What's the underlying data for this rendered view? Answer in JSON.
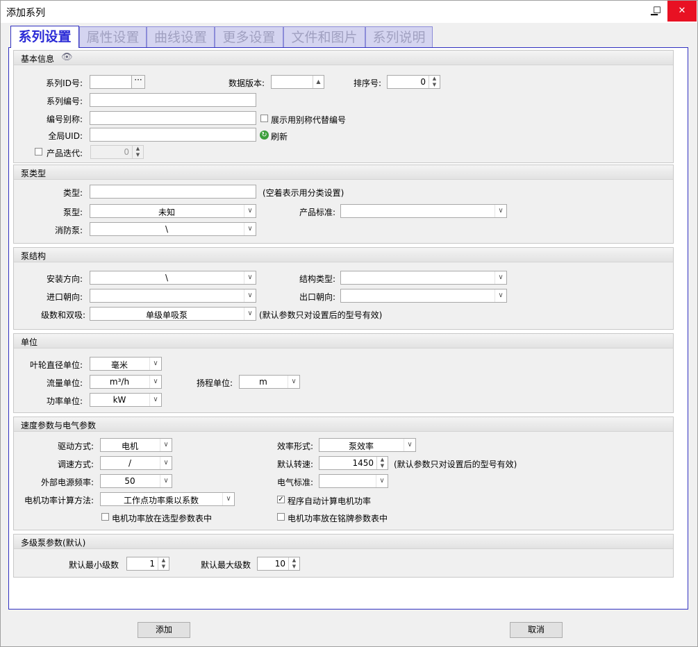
{
  "window": {
    "title": "添加系列",
    "min": "▁",
    "max": "☐",
    "close": "✕"
  },
  "tabs": [
    "系列设置",
    "属性设置",
    "曲线设置",
    "更多设置",
    "文件和图片",
    "系列说明"
  ],
  "basic": {
    "title": "基本信息",
    "series_id_label": "系列ID号:",
    "series_id_btn": "···",
    "data_version_label": "数据版本:",
    "sort_label": "排序号:",
    "sort_value": "0",
    "series_code_label": "系列编号:",
    "alias_label": "编号别称:",
    "alias_check_label": "展示用别称代替编号",
    "uid_label": "全局UID:",
    "refresh_label": "刷新",
    "iteration_label": "产品迭代:",
    "iteration_value": "0"
  },
  "pumptype": {
    "title": "泵类型",
    "type_label": "类型:",
    "type_hint": "(空着表示用分类设置)",
    "pump_label": "泵型:",
    "pump_value": "未知",
    "standard_label": "产品标准:",
    "standard_value": "",
    "fire_label": "消防泵:",
    "fire_value": "\\"
  },
  "structure": {
    "title": "泵结构",
    "install_label": "安装方向:",
    "install_value": "\\",
    "struct_type_label": "结构类型:",
    "struct_type_value": "",
    "inlet_label": "进口朝向:",
    "inlet_value": "",
    "outlet_label": "出口朝向:",
    "outlet_value": "",
    "stage_label": "级数和双吸:",
    "stage_value": "单级单吸泵",
    "stage_hint": "(默认参数只对设置后的型号有效)"
  },
  "units": {
    "title": "单位",
    "impeller_label": "叶轮直径单位:",
    "impeller_value": "毫米",
    "flow_label": "流量单位:",
    "flow_value": "m³/h",
    "head_label": "扬程单位:",
    "head_value": "m",
    "power_label": "功率单位:",
    "power_value": "kW"
  },
  "speed": {
    "title": "速度参数与电气参数",
    "drive_label": "驱动方式:",
    "drive_value": "电机",
    "eff_label": "效率形式:",
    "eff_value": "泵效率",
    "speedreg_label": "调速方式:",
    "speedreg_value": "/",
    "default_speed_label": "默认转速:",
    "default_speed_value": "1450",
    "default_speed_hint": "(默认参数只对设置后的型号有效)",
    "freq_label": "外部电源频率:",
    "freq_value": "50",
    "elec_std_label": "电气标准:",
    "elec_std_value": "",
    "motor_calc_label": "电机功率计算方法:",
    "motor_calc_value": "工作点功率乘以系数",
    "auto_calc_label": "程序自动计算电机功率",
    "in_select_label": "电机功率放在选型参数表中",
    "in_nameplate_label": "电机功率放在铭牌参数表中"
  },
  "multistage": {
    "title": "多级泵参数(默认)",
    "min_label": "默认最小级数",
    "min_value": "1",
    "max_label": "默认最大级数",
    "max_value": "10"
  },
  "footer": {
    "add_label": "添加",
    "cancel_label": "取消"
  }
}
